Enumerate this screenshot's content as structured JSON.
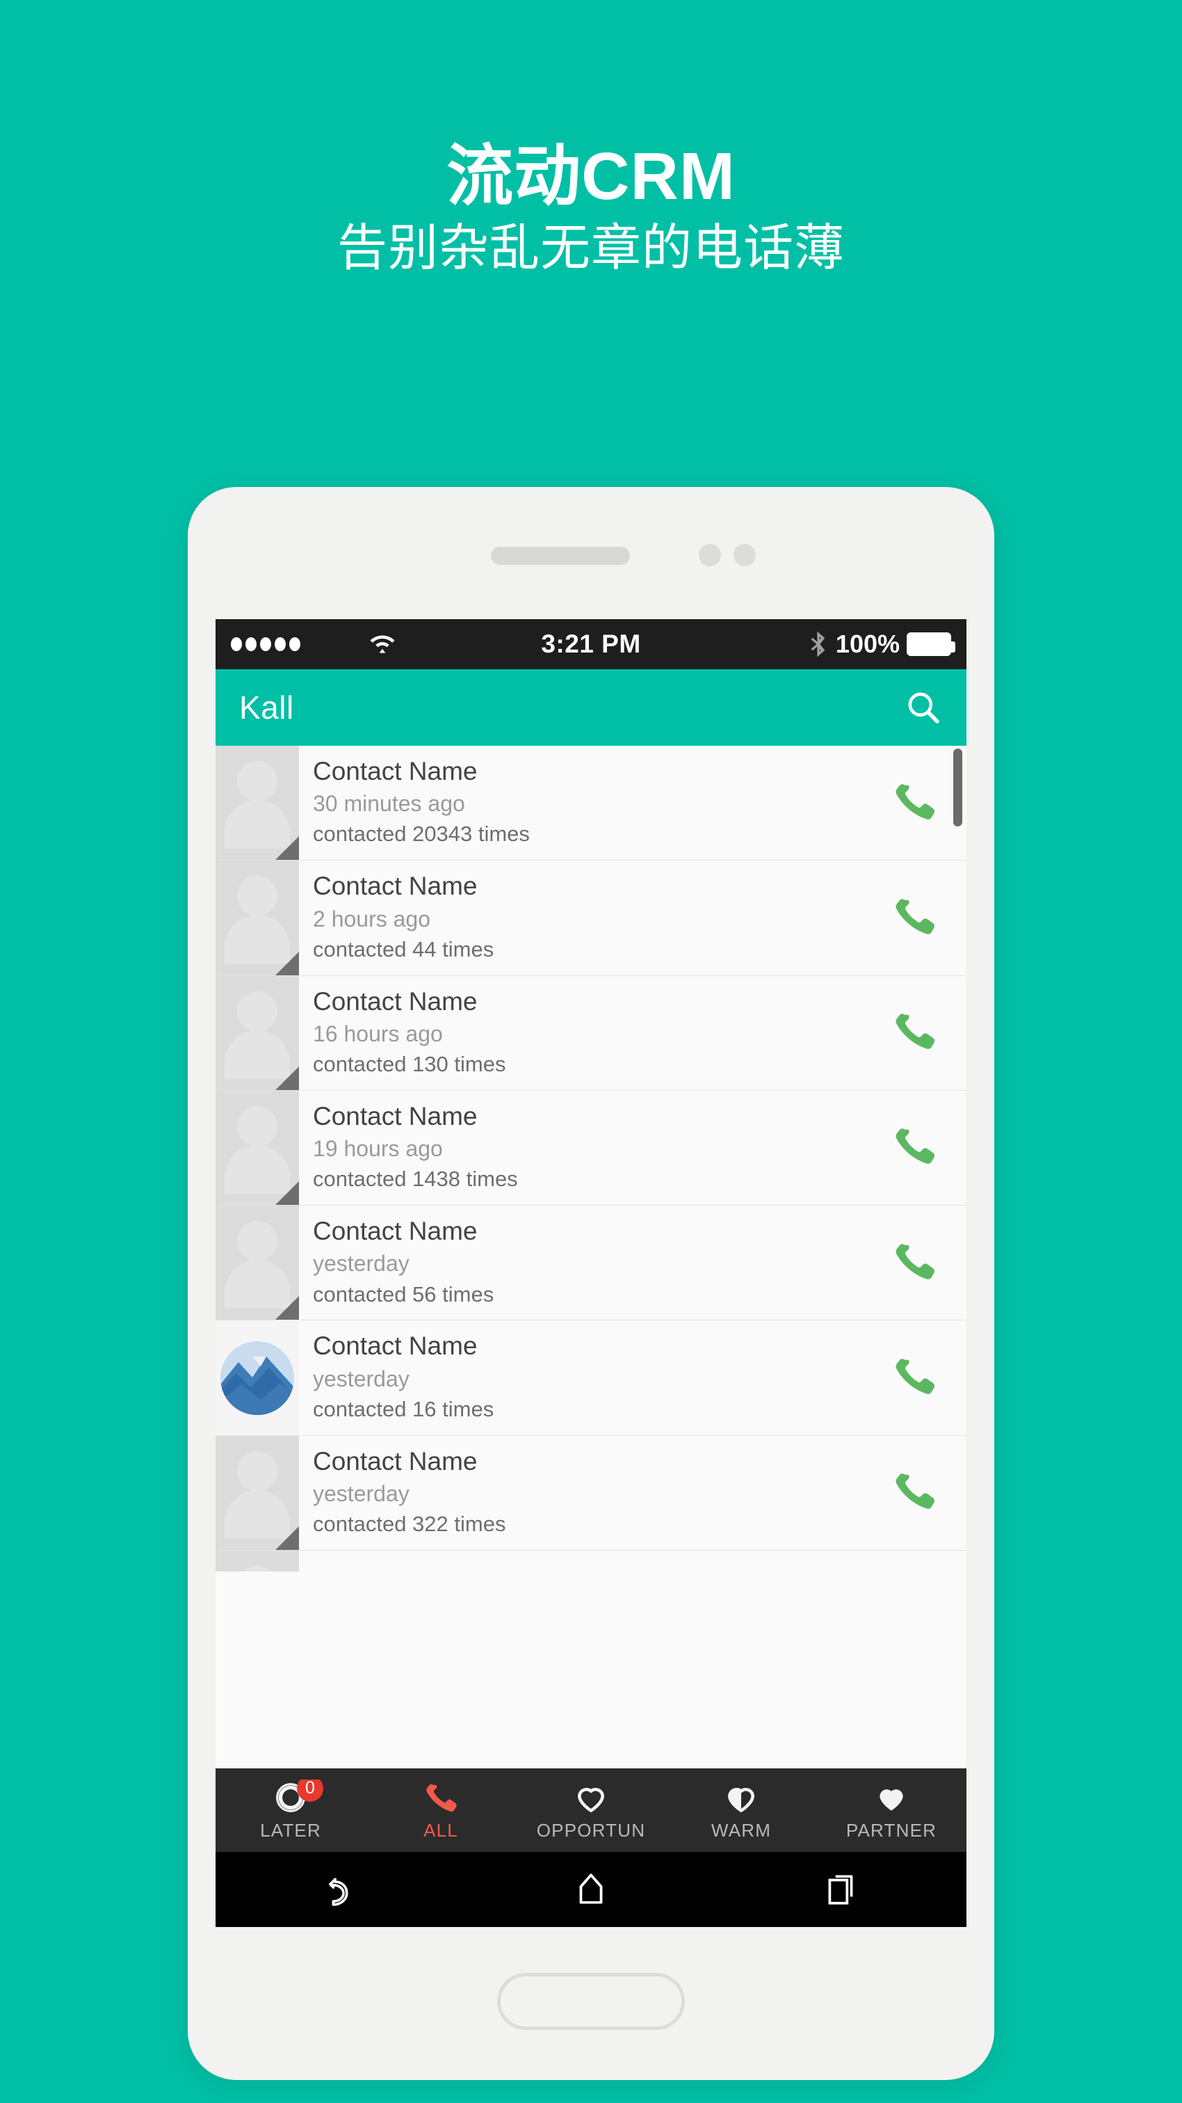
{
  "promo": {
    "title": "流动CRM",
    "subtitle": "告别杂乱无章的电话薄"
  },
  "colors": {
    "brand_teal": "#00BFA5",
    "status_bar": "#1E1E1E",
    "tab_bar": "#2B2B2B",
    "active_tab": "#F2594B",
    "call_icon_green": "#5CB860",
    "badge_red": "#E8392E",
    "phone_body": "#F2F2F0"
  },
  "status_bar": {
    "signal_dots": 5,
    "wifi_icon": "wifi-icon",
    "time": "3:21 PM",
    "bluetooth_icon": "bluetooth-icon",
    "battery_percent": "100%",
    "battery_icon": "battery-full-icon"
  },
  "app_bar": {
    "title": "Kall",
    "search_icon": "search-icon"
  },
  "contacts": [
    {
      "name": "Contact Name",
      "time": "30 minutes ago",
      "count": "contacted 20343 times",
      "avatar": "default",
      "call_icon": "phone-icon"
    },
    {
      "name": "Contact Name",
      "time": "2 hours ago",
      "count": "contacted 44 times",
      "avatar": "default",
      "call_icon": "phone-icon"
    },
    {
      "name": "Contact Name",
      "time": "16 hours ago",
      "count": "contacted 130 times",
      "avatar": "default",
      "call_icon": "phone-icon"
    },
    {
      "name": "Contact Name",
      "time": "19 hours ago",
      "count": "contacted 1438 times",
      "avatar": "default",
      "call_icon": "phone-icon"
    },
    {
      "name": "Contact Name",
      "time": "yesterday",
      "count": "contacted 56 times",
      "avatar": "default",
      "call_icon": "phone-icon"
    },
    {
      "name": "Contact Name",
      "time": "yesterday",
      "count": "contacted 16 times",
      "avatar": "photo",
      "call_icon": "phone-icon"
    },
    {
      "name": "Contact Name",
      "time": "yesterday",
      "count": "contacted 322 times",
      "avatar": "default",
      "call_icon": "phone-icon"
    }
  ],
  "tabs": [
    {
      "label": "LATER",
      "icon": "clock-icon",
      "badge": "0",
      "active": false
    },
    {
      "label": "ALL",
      "icon": "phone-icon",
      "badge": "",
      "active": true
    },
    {
      "label": "OPPORTUN",
      "icon": "heart-outline-icon",
      "badge": "",
      "active": false
    },
    {
      "label": "WARM",
      "icon": "heart-half-icon",
      "badge": "",
      "active": false
    },
    {
      "label": "PARTNER",
      "icon": "heart-filled-icon",
      "badge": "",
      "active": false
    }
  ],
  "android_nav": {
    "back": "back-arrow-icon",
    "home": "home-icon",
    "recents": "recents-icon"
  }
}
